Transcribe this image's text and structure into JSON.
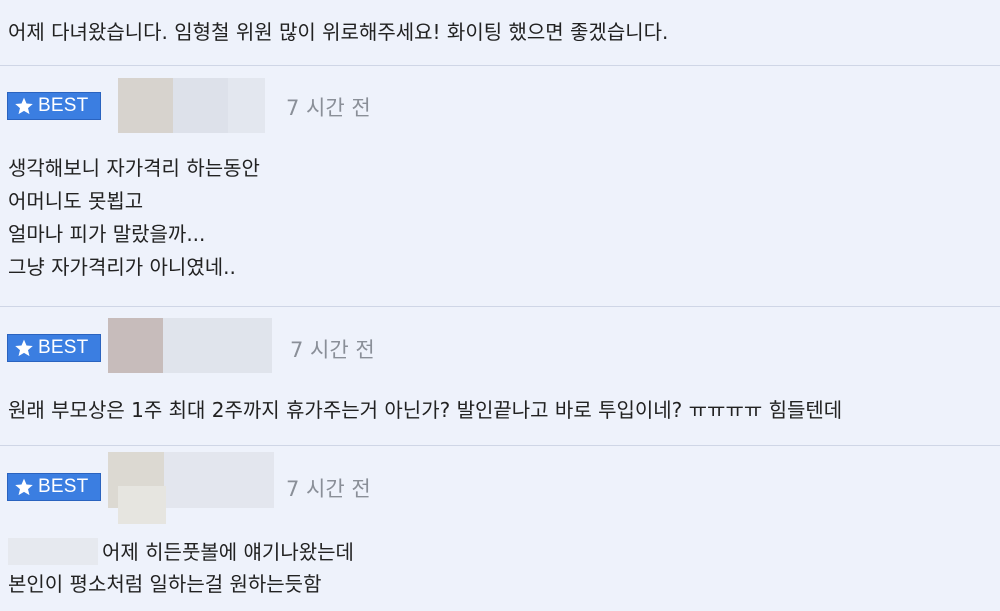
{
  "comments": [
    {
      "lines": [
        "어제 다녀왔습니다. 임형철 위원 많이 위로해주세요! 화이팅 했으면 좋겠습니다."
      ]
    },
    {
      "badge": "BEST",
      "time": "7 시간 전",
      "lines": [
        "생각해보니 자가격리 하는동안",
        "어머니도 못뵙고",
        "얼마나 피가 말랐을까...",
        "그냥 자가격리가 아니였네.."
      ]
    },
    {
      "badge": "BEST",
      "time": "7 시간 전",
      "lines": [
        "원래 부모상은 1주 최대 2주까지 휴가주는거 아닌가? 발인끝나고 바로 투입이네? ㅠㅠㅠㅠ 힘들텐데"
      ]
    },
    {
      "badge": "BEST",
      "time": "7 시간 전",
      "lines": [
        "어제 히든풋볼에 얘기나왔는데",
        "본인이 평소처럼 일하는걸 원하는듯함"
      ]
    }
  ],
  "colors": {
    "background": "#eef2fb",
    "badge": "#3b7ee1",
    "divider": "#cfd6e6",
    "time": "#8a8f98"
  },
  "icons": {
    "badge_icon": "star-icon"
  }
}
